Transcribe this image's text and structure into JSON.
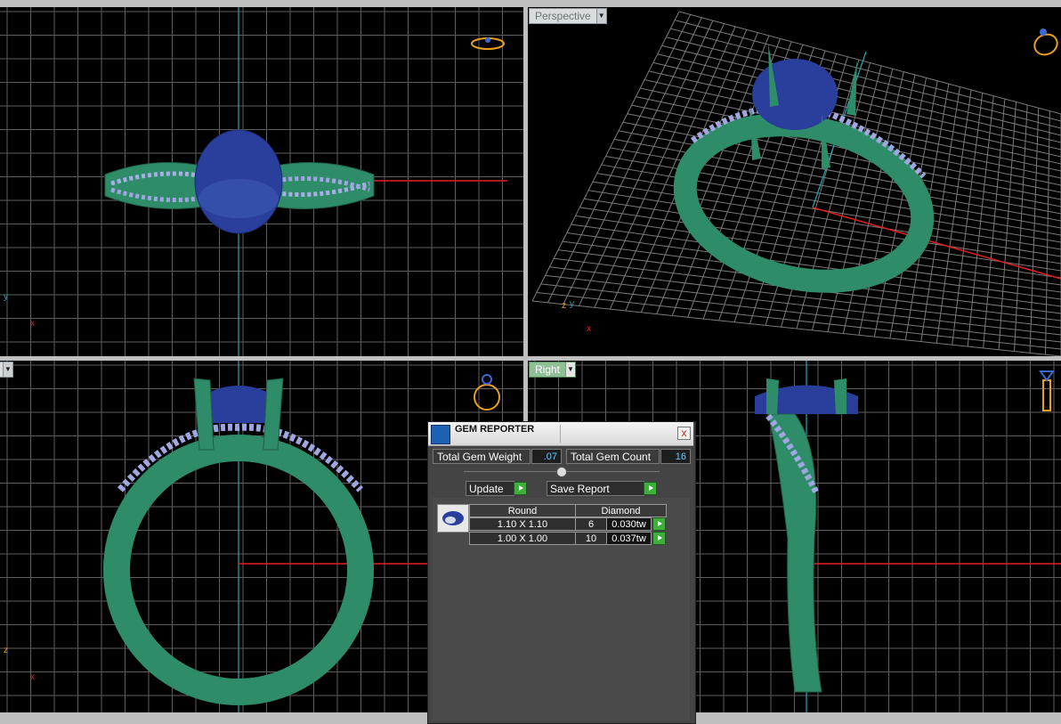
{
  "viewports": {
    "top": {
      "label": "",
      "axes": {
        "y": "y",
        "x": "x"
      }
    },
    "perspective": {
      "label": "Perspective",
      "axes": {
        "z": "z",
        "y": "y",
        "x": "x"
      }
    },
    "front": {
      "label": "",
      "axes": {
        "z": "z",
        "x": "x"
      }
    },
    "right": {
      "label": "Right"
    }
  },
  "gem_reporter": {
    "title": "GEM REPORTER",
    "close": "x",
    "total_weight_label": "Total Gem Weight",
    "total_weight_value": ".07",
    "total_count_label": "Total Gem Count",
    "total_count_value": "16",
    "update_label": "Update",
    "save_report_label": "Save Report",
    "table": {
      "cut": "Round",
      "material": "Diamond",
      "rows": [
        {
          "size": "1.10 X 1.10",
          "count": "6",
          "weight": "0.030tw"
        },
        {
          "size": "1.00 X 1.00",
          "count": "10",
          "weight": "0.037tw"
        }
      ]
    }
  },
  "colors": {
    "ring_metal": "#2e8c69",
    "gem_center": "#2a3f9b",
    "accent_stones": "#9fa6e0",
    "grid_line": "#6d6d6d",
    "axis_red": "#e02020",
    "axis_cyan": "#2aa6b8"
  }
}
